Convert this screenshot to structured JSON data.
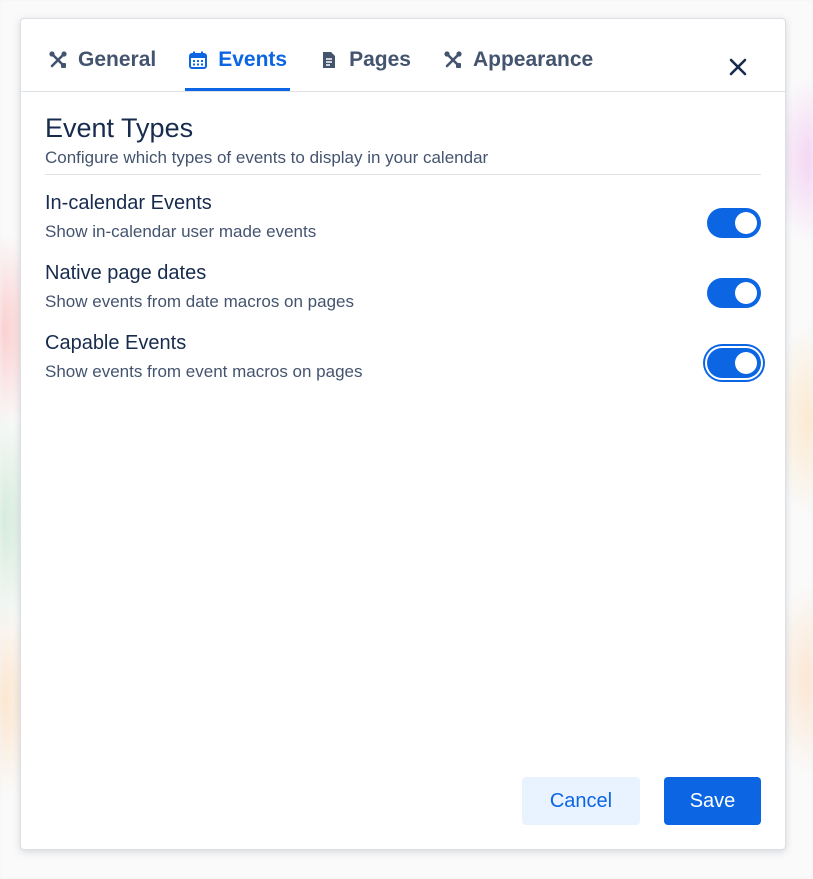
{
  "tabs": [
    {
      "label": "General",
      "icon": "tools-icon",
      "active": false
    },
    {
      "label": "Events",
      "icon": "calendar-icon",
      "active": true
    },
    {
      "label": "Pages",
      "icon": "document-icon",
      "active": false
    },
    {
      "label": "Appearance",
      "icon": "tools-icon",
      "active": false
    }
  ],
  "section": {
    "title": "Event Types",
    "description": "Configure which types of events to display in your calendar"
  },
  "settings": [
    {
      "label": "In-calendar Events",
      "description": "Show in-calendar user made events",
      "enabled": true
    },
    {
      "label": "Native page dates",
      "description": "Show events from date macros on pages",
      "enabled": true
    },
    {
      "label": "Capable Events",
      "description": "Show events from event macros on pages",
      "enabled": true,
      "focused": true
    }
  ],
  "footer": {
    "cancel_label": "Cancel",
    "save_label": "Save"
  },
  "colors": {
    "accent": "#0c66e4",
    "text_primary": "#172b4d",
    "text_secondary": "#44546f"
  }
}
